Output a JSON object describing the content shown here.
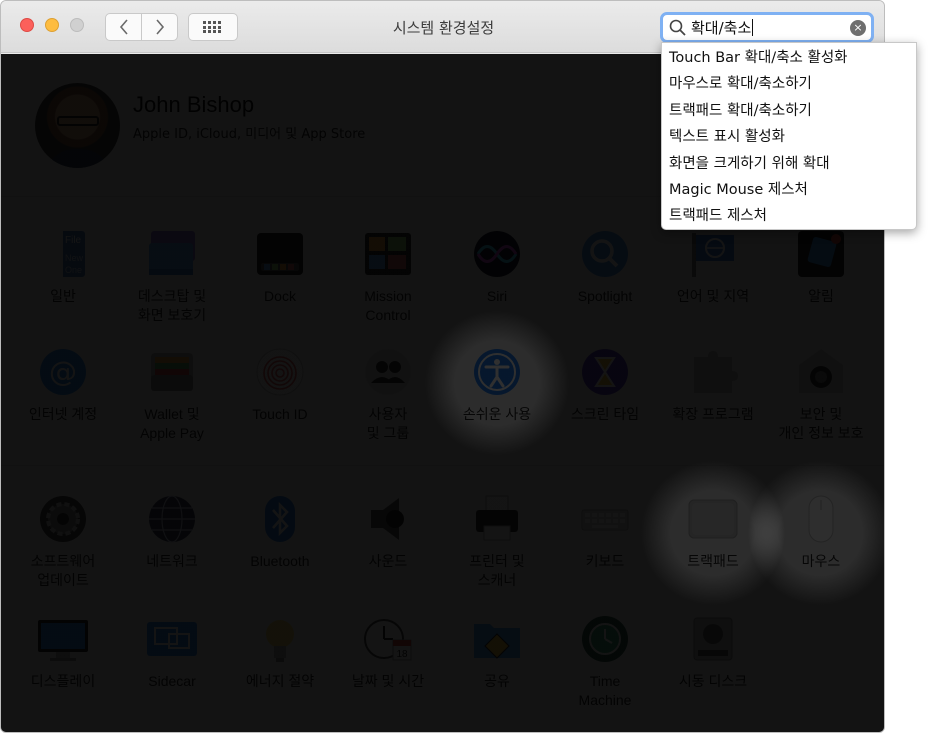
{
  "window": {
    "title": "시스템 환경설정"
  },
  "toolbar": {
    "back": "<",
    "forward": ">",
    "show_all": "show-all-grid-icon"
  },
  "search": {
    "value": "확대/축소",
    "clear": "×"
  },
  "suggestions": [
    "Touch Bar 확대/축소 활성화",
    "마우스로 확대/축소하기",
    "트랙패드 확대/축소하기",
    "텍스트 표시 활성화",
    "화면을 크게하기 위해 확대",
    "Magic Mouse 제스처",
    "트랙패드 제스처"
  ],
  "user": {
    "name": "John Bishop",
    "subtitle": "Apple ID, iCloud, 미디어 및 App Store"
  },
  "panes": [
    {
      "label": "일반",
      "icon": "general-icon"
    },
    {
      "label": "데스크탑 및\n화면 보호기",
      "icon": "desktop-screensaver-icon"
    },
    {
      "label": "Dock",
      "icon": "dock-icon"
    },
    {
      "label": "Mission\nControl",
      "icon": "mission-control-icon"
    },
    {
      "label": "Siri",
      "icon": "siri-icon"
    },
    {
      "label": "Spotlight",
      "icon": "spotlight-icon"
    },
    {
      "label": "언어 및 지역",
      "icon": "language-region-icon"
    },
    {
      "label": "알림",
      "icon": "notifications-icon"
    },
    {
      "label": "인터넷 계정",
      "icon": "internet-accounts-icon"
    },
    {
      "label": "Wallet 및\nApple Pay",
      "icon": "wallet-icon"
    },
    {
      "label": "Touch ID",
      "icon": "touch-id-icon"
    },
    {
      "label": "사용자\n및 그룹",
      "icon": "users-groups-icon"
    },
    {
      "label": "손쉬운 사용",
      "icon": "accessibility-icon"
    },
    {
      "label": "스크린 타임",
      "icon": "screen-time-icon"
    },
    {
      "label": "확장 프로그램",
      "icon": "extensions-icon"
    },
    {
      "label": "보안 및\n개인 정보 보호",
      "icon": "security-privacy-icon"
    },
    {
      "label": "소프트웨어\n업데이트",
      "icon": "software-update-icon"
    },
    {
      "label": "네트워크",
      "icon": "network-icon"
    },
    {
      "label": "Bluetooth",
      "icon": "bluetooth-icon"
    },
    {
      "label": "사운드",
      "icon": "sound-icon"
    },
    {
      "label": "프린터 및\n스캐너",
      "icon": "printers-scanners-icon"
    },
    {
      "label": "키보드",
      "icon": "keyboard-icon"
    },
    {
      "label": "트랙패드",
      "icon": "trackpad-icon"
    },
    {
      "label": "마우스",
      "icon": "mouse-icon"
    },
    {
      "label": "디스플레이",
      "icon": "displays-icon"
    },
    {
      "label": "Sidecar",
      "icon": "sidecar-icon"
    },
    {
      "label": "에너지 절약",
      "icon": "energy-saver-icon"
    },
    {
      "label": "날짜 및 시간",
      "icon": "date-time-icon"
    },
    {
      "label": "공유",
      "icon": "sharing-icon"
    },
    {
      "label": "Time\nMachine",
      "icon": "time-machine-icon"
    },
    {
      "label": "시동 디스크",
      "icon": "startup-disk-icon"
    }
  ],
  "highlighted": [
    "손쉬운 사용",
    "트랙패드",
    "마우스"
  ],
  "colors": {
    "accent": "#1f7cf0",
    "search_focus": "#7fb1f3",
    "dim": "#000000"
  }
}
